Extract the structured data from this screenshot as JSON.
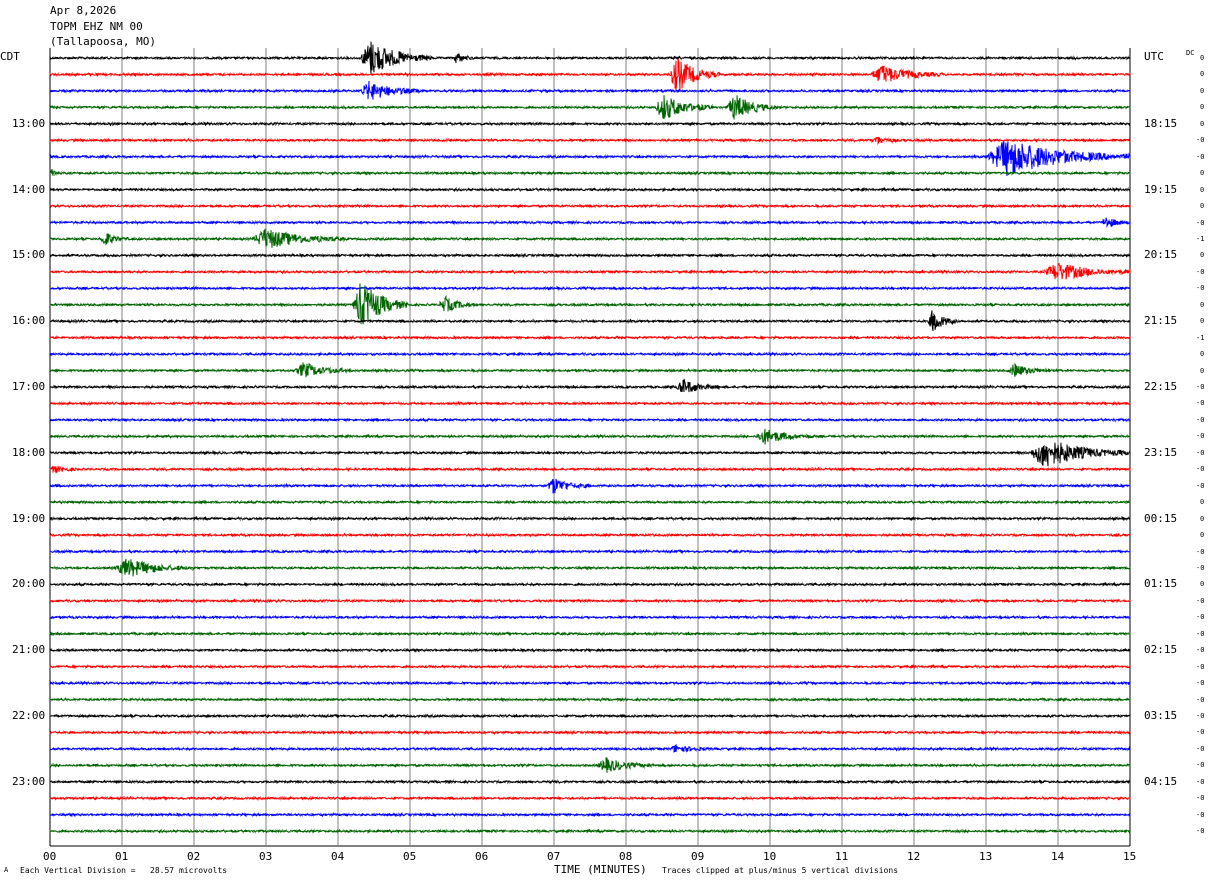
{
  "header": {
    "date": "Apr 8,2026",
    "station": "TOPM EHZ NM 00",
    "location": "(Tallapoosa, MO)"
  },
  "left_tz": "CDT",
  "right_tz": "UTC",
  "dc_label": "DC",
  "left_times": [
    "13:00",
    "14:00",
    "15:00",
    "16:00",
    "17:00",
    "18:00",
    "19:00",
    "20:00",
    "21:00",
    "22:00",
    "23:00"
  ],
  "right_times": [
    "18:15",
    "19:15",
    "20:15",
    "21:15",
    "22:15",
    "23:15",
    "00:15",
    "01:15",
    "02:15",
    "03:15",
    "04:15"
  ],
  "dc_values": [
    "0",
    "0",
    "0",
    "0",
    "0",
    "-0",
    "-0",
    "0",
    "0",
    "0",
    "-0",
    "-1",
    "0",
    "-0",
    "-0",
    "0",
    "0",
    "-1",
    "0",
    "0",
    "-0",
    "-0",
    "-0",
    "-0",
    "-0",
    "-0",
    "-0",
    "0",
    "0",
    "0",
    "-0",
    "-0",
    "0",
    "-0",
    "-0",
    "-0",
    "-0",
    "-0",
    "-0",
    "-0",
    "-0",
    "-0",
    "-0",
    "-0",
    "-0",
    "-0",
    "-0",
    "-0"
  ],
  "x_ticks": [
    "00",
    "01",
    "02",
    "03",
    "04",
    "05",
    "06",
    "07",
    "08",
    "09",
    "10",
    "11",
    "12",
    "13",
    "14",
    "15"
  ],
  "xlabel": "TIME (MINUTES)",
  "footer": {
    "scale": "Each Vertical Division =   28.57 microvolts",
    "clip": "Traces clipped at plus/minus 5 vertical divisions",
    "mark": "A"
  },
  "colors": {
    "trace_cycle": [
      "#000000",
      "#ff0000",
      "#0000ff",
      "#006400"
    ],
    "grid": "#808080"
  },
  "chart_data": {
    "type": "line",
    "description_x_unit": "minutes",
    "xlim": [
      0,
      15
    ],
    "trace_count": 48,
    "events": [
      {
        "trace": 0,
        "start": 4.3,
        "end": 5.3,
        "amp": 3.0
      },
      {
        "trace": 0,
        "start": 5.6,
        "end": 5.9,
        "amp": 0.9
      },
      {
        "trace": 1,
        "start": 8.6,
        "end": 9.3,
        "amp": 3.0
      },
      {
        "trace": 1,
        "start": 11.4,
        "end": 12.4,
        "amp": 1.6
      },
      {
        "trace": 2,
        "start": 4.3,
        "end": 5.2,
        "amp": 1.6
      },
      {
        "trace": 3,
        "start": 8.4,
        "end": 9.2,
        "amp": 2.2
      },
      {
        "trace": 3,
        "start": 9.4,
        "end": 10.1,
        "amp": 2.2
      },
      {
        "trace": 5,
        "start": 11.4,
        "end": 11.9,
        "amp": 0.6
      },
      {
        "trace": 6,
        "start": 13.0,
        "end": 15.0,
        "amp": 3.2
      },
      {
        "trace": 7,
        "start": 0.0,
        "end": 0.2,
        "amp": 0.6
      },
      {
        "trace": 10,
        "start": 14.6,
        "end": 15.0,
        "amp": 1.0
      },
      {
        "trace": 11,
        "start": 0.7,
        "end": 1.1,
        "amp": 1.2
      },
      {
        "trace": 11,
        "start": 2.8,
        "end": 4.1,
        "amp": 1.8
      },
      {
        "trace": 13,
        "start": 13.8,
        "end": 15.0,
        "amp": 1.6
      },
      {
        "trace": 15,
        "start": 4.2,
        "end": 5.0,
        "amp": 4.0
      },
      {
        "trace": 15,
        "start": 5.4,
        "end": 5.9,
        "amp": 1.4
      },
      {
        "trace": 16,
        "start": 12.2,
        "end": 12.6,
        "amp": 2.0
      },
      {
        "trace": 19,
        "start": 3.4,
        "end": 4.2,
        "amp": 1.3
      },
      {
        "trace": 19,
        "start": 13.3,
        "end": 13.9,
        "amp": 1.1
      },
      {
        "trace": 20,
        "start": 8.7,
        "end": 9.3,
        "amp": 1.3
      },
      {
        "trace": 23,
        "start": 9.8,
        "end": 10.6,
        "amp": 1.3
      },
      {
        "trace": 24,
        "start": 13.6,
        "end": 15.0,
        "amp": 2.6
      },
      {
        "trace": 25,
        "start": 0.0,
        "end": 0.4,
        "amp": 0.6
      },
      {
        "trace": 26,
        "start": 6.9,
        "end": 7.5,
        "amp": 1.4
      },
      {
        "trace": 31,
        "start": 0.9,
        "end": 2.0,
        "amp": 1.6
      },
      {
        "trace": 42,
        "start": 8.6,
        "end": 9.2,
        "amp": 0.6
      },
      {
        "trace": 43,
        "start": 7.6,
        "end": 8.4,
        "amp": 1.2
      }
    ]
  }
}
